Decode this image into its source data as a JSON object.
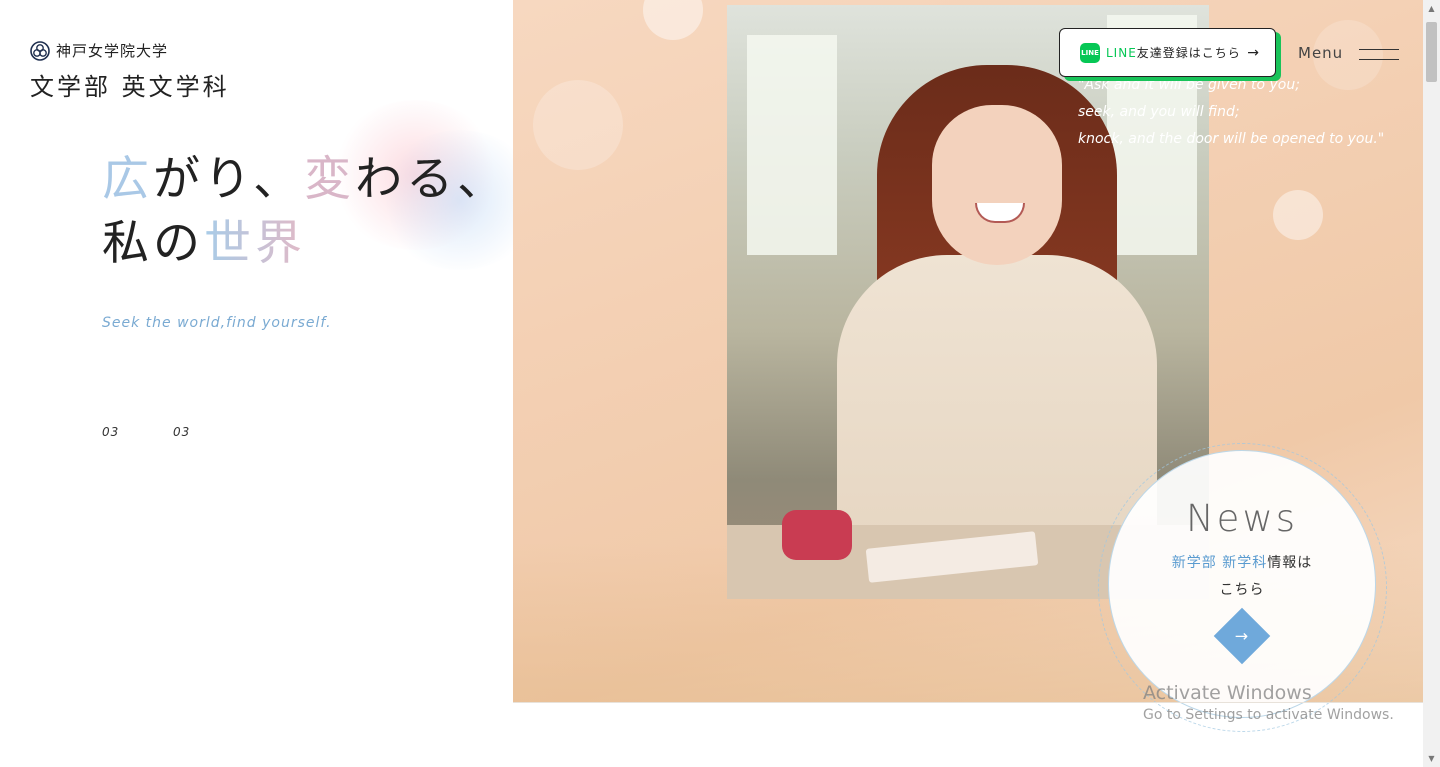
{
  "logo": {
    "university": "神戸女学院大学",
    "department": "文学部 英文学科"
  },
  "hero": {
    "headline_line1": [
      "広",
      "が",
      "り、",
      "変",
      "わ",
      "る、"
    ],
    "headline_line2_a": "私の",
    "headline_line2_b": "世界",
    "tagline": "Seek the world,find yourself.",
    "counter_current": "03",
    "counter_total": "03",
    "quote_lines": [
      "\"Ask and it will be given to you;",
      "seek, and you will find;",
      "knock, and the door will be opened to you.\""
    ]
  },
  "line_button": {
    "label_line": "LINE",
    "label_rest": "友達登録はこちら",
    "icon_text": "LINE",
    "arrow": "→"
  },
  "menu": {
    "label": "Menu"
  },
  "news": {
    "title": "News",
    "sub_part1": "新学部",
    "sub_part2": "新学科",
    "sub_part3": "情報は",
    "sub_line2": "こちら",
    "arrow": "→"
  },
  "watermark": {
    "title": "Activate Windows",
    "subtitle": "Go to Settings to activate Windows."
  },
  "colors": {
    "accent_blue": "#6fa9db",
    "line_green": "#06c755",
    "headline_blue": "#a9c8e6",
    "headline_pink": "#d9b6c8"
  },
  "icons": {
    "logo_mark": "university-crest-icon",
    "line": "line-app-icon",
    "menu": "hamburger-icon",
    "news_arrow": "arrow-right-icon"
  }
}
